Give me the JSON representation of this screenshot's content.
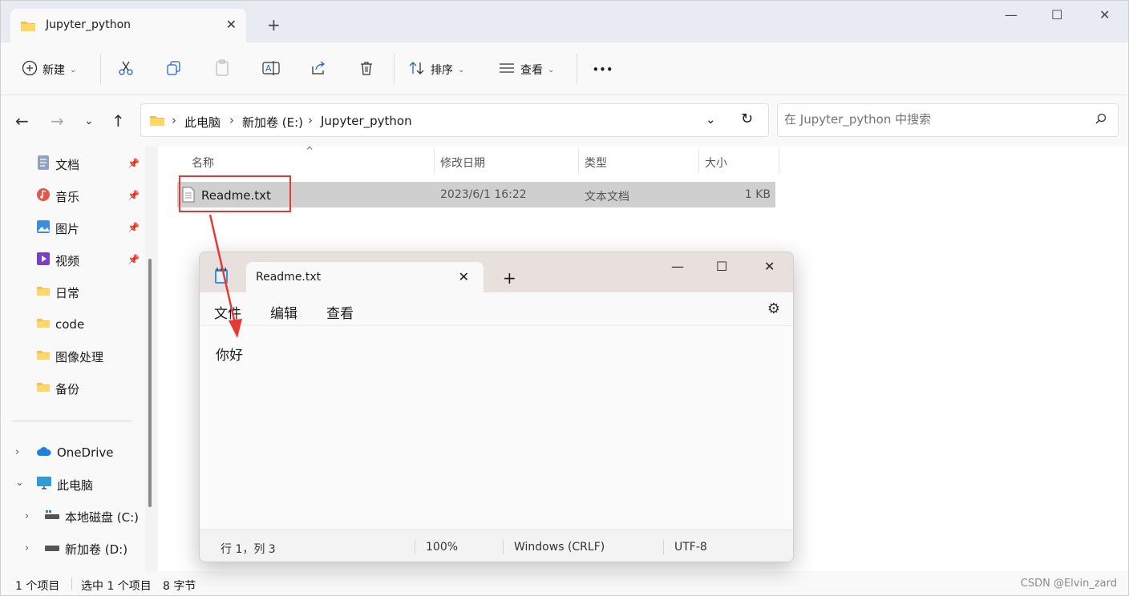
{
  "explorer": {
    "tab_title": "Jupyter_python",
    "toolbar": {
      "new_label": "新建",
      "sort_label": "排序",
      "view_label": "查看",
      "more_label": "•••"
    },
    "breadcrumb": [
      "此电脑",
      "新加卷 (E:)",
      "Jupyter_python"
    ],
    "search_placeholder": "在 Jupyter_python 中搜索",
    "sidebar": {
      "quick": [
        {
          "label": "文档",
          "icon": "documents-icon"
        },
        {
          "label": "音乐",
          "icon": "music-icon"
        },
        {
          "label": "图片",
          "icon": "pictures-icon"
        },
        {
          "label": "视频",
          "icon": "videos-icon"
        },
        {
          "label": "日常",
          "icon": "folder-icon"
        },
        {
          "label": "code",
          "icon": "folder-icon"
        },
        {
          "label": "图像处理",
          "icon": "folder-icon"
        },
        {
          "label": "备份",
          "icon": "folder-icon"
        }
      ],
      "onedrive": "OneDrive",
      "thispc": "此电脑",
      "drives": [
        "本地磁盘 (C:)",
        "新加卷 (D:)"
      ]
    },
    "columns": {
      "name": "名称",
      "date": "修改日期",
      "type": "类型",
      "size": "大小"
    },
    "files": [
      {
        "name": "Readme.txt",
        "date": "2023/6/1 16:22",
        "type": "文本文档",
        "size": "1 KB"
      }
    ],
    "status": {
      "count": "1 个项目",
      "selected": "选中 1 个项目",
      "bytes": "8 字节"
    },
    "watermark": "CSDN @Elvin_zard"
  },
  "notepad": {
    "tab_title": "Readme.txt",
    "menu": [
      "文件",
      "编辑",
      "查看"
    ],
    "content": "你好",
    "status": {
      "position": "行 1，列 3",
      "zoom": "100%",
      "line_ending": "Windows (CRLF)",
      "encoding": "UTF-8"
    }
  },
  "colors": {
    "highlight": "#e53935",
    "selection": "#cfcfcf"
  }
}
